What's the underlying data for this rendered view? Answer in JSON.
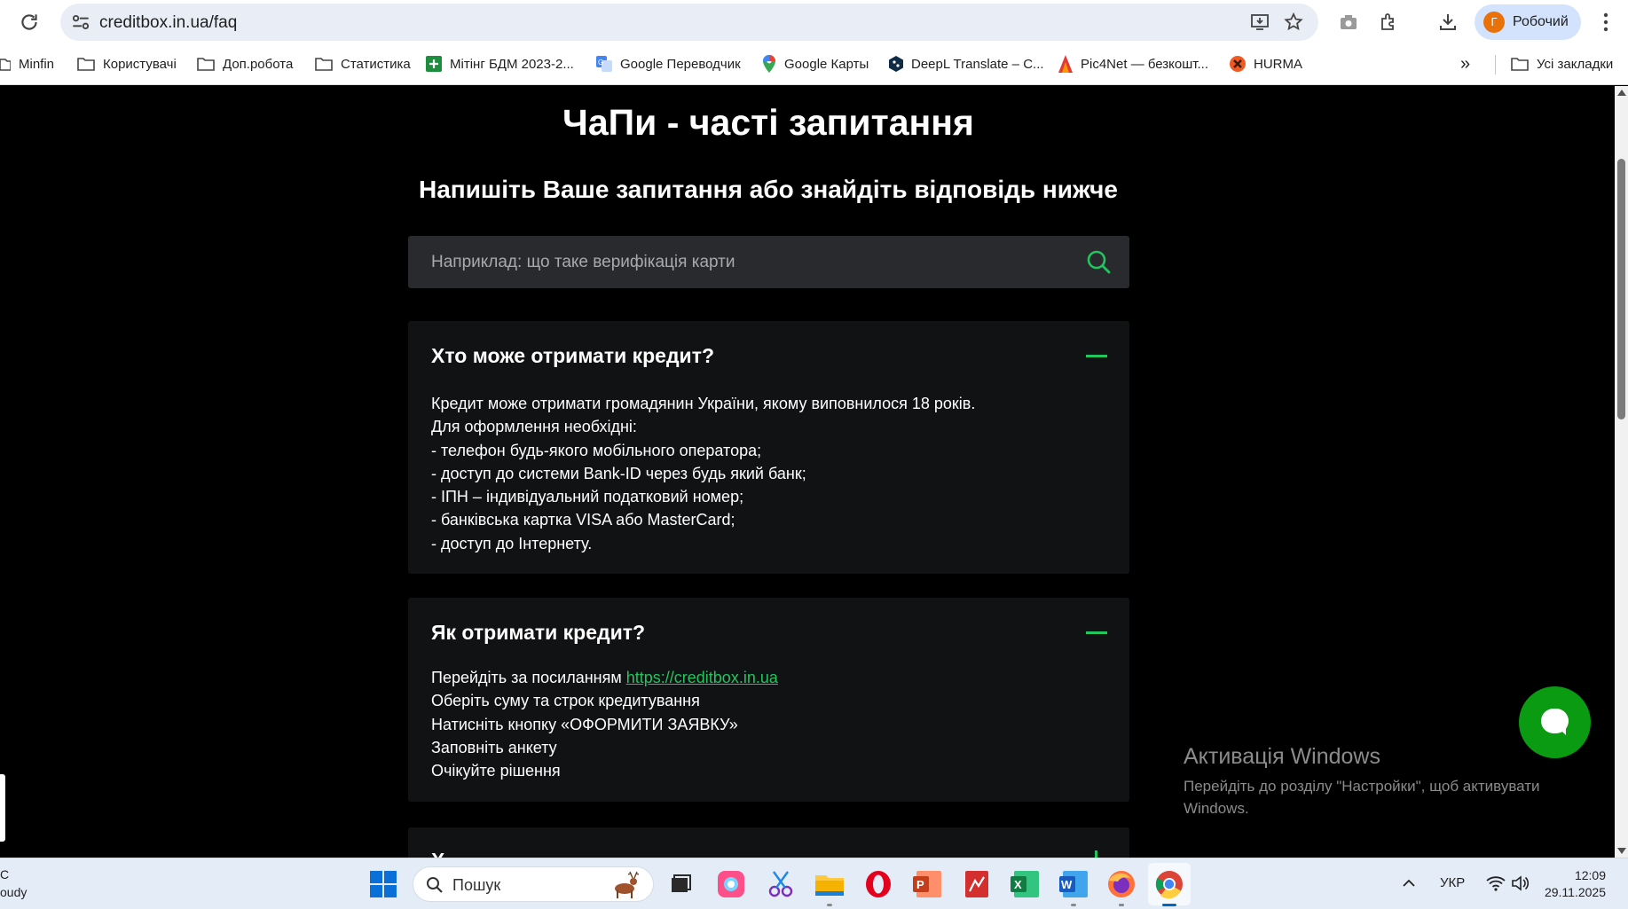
{
  "browser": {
    "url": "creditbox.in.ua/faq",
    "profile_initial": "Г",
    "profile_label": "Робочий",
    "bookmarks": [
      "Minfin",
      "Користувачі",
      "Доп.робота",
      "Статистика",
      "Мітінг БДМ 2023-2...",
      "Google Переводчик",
      "Google Карты",
      "DeepL Translate – C...",
      "Pic4Net — безкошт...",
      "HURMA"
    ],
    "overflow": "»",
    "all_bookmarks": "Усі закладки"
  },
  "page": {
    "title": "ЧаПи - часті запитання",
    "subtitle": "Напишіть Ваше запитання або знайдіть відповідь нижче",
    "search_placeholder": "Наприклад: що таке верифікація карти",
    "faq": [
      {
        "question": "Хто може отримати кредит?",
        "answer_lines": [
          "Кредит може отримати громадянин України, якому виповнилося 18 років.",
          "Для оформлення необхідні:",
          "- телефон будь-якого мобільного оператора;",
          "- доступ до системи Bank-ID через будь який банк;",
          "- ІПН – індивідуальний податковий номер;",
          "- банківська картка VISA або MasterCard;",
          "- доступ до Інтернету."
        ]
      },
      {
        "question": "Як отримати кредит?",
        "answer_line1_prefix": "Перейдіть за посиланням ",
        "answer_link": "https://creditbox.in.ua",
        "answer_lines": [
          "Оберіть суму та строк кредитування",
          "Натисніть кнопку «ОФОРМИТИ ЗАЯВКУ»",
          "Заповніть анкету",
          "Очікуйте рішення"
        ]
      },
      {
        "question": "Х"
      }
    ]
  },
  "watermark": {
    "title": "Активація Windows",
    "text": "Перейдіть до розділу \"Настройки\", щоб активувати Windows."
  },
  "taskbar": {
    "weather_line1": "C",
    "weather_line2": "oudy",
    "search_placeholder": "Пошук",
    "language": "УКР",
    "time": "12:09",
    "date": "29.11.2025"
  },
  "colors": {
    "accent": "#22c55e",
    "chat_button": "#0a9b12",
    "card_bg": "#111214",
    "search_bg": "#282a2e"
  }
}
